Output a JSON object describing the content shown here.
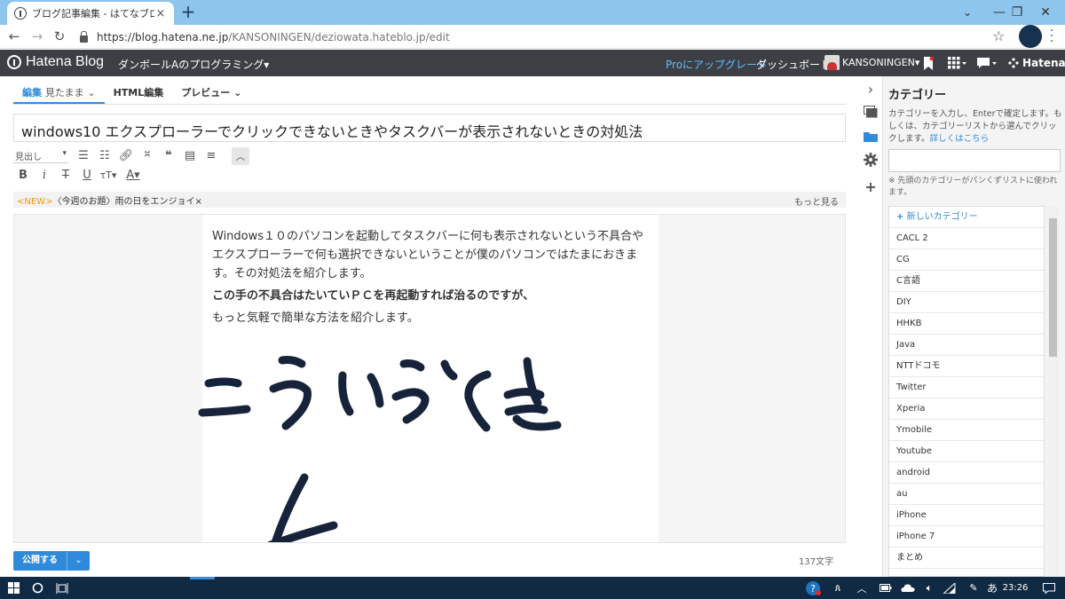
{
  "browser": {
    "tab_title": "ブログ記事編集 - はてなブログ",
    "tab_close": "×",
    "new_tab": "+",
    "url_host": "https://blog.hatena.ne.jp",
    "url_path": "/KANSONINGEN/deziowata.hateblo.jp/edit",
    "window_controls": [
      "⌄",
      "—",
      "❐",
      "✕"
    ]
  },
  "header": {
    "logo": "Hatena Blog",
    "blog_name": "ダンボールAのプログラミング▾",
    "pro_link": "Proにアップグレード",
    "dashboard": "ダッシュボード",
    "username": "KANSONINGEN▾",
    "hatena_link": "Hatena"
  },
  "editor": {
    "tabs": [
      {
        "label": "編集",
        "sub": "見たまま"
      },
      {
        "label": "HTML編集"
      },
      {
        "label": "プレビュー"
      }
    ],
    "title": "windows10 エクスプローラーでクリックできないときやタスクバーが表示されないときの対処法",
    "heading_select": "見出し",
    "notice_new": "<NEW>",
    "notice_text": "〈今週のお題〉雨の日をエンジョイ",
    "notice_close": "×",
    "notice_more": "もっと見る",
    "paragraph1": "Windows１０のパソコンを起動してタスクバーに何も表示されないという不具合やエクスプローラーで何も選択できないということが僕のパソコンではたまにおきます。その対処法を紹介します。",
    "paragraph2": "この手の不具合はたいていＰＣを再起動すれば治るのですが、",
    "paragraph3": "もっと気軽で簡単な方法を紹介します。",
    "publish_label": "公開する",
    "char_count": "137文字"
  },
  "category_panel": {
    "title": "カテゴリー",
    "description": "カテゴリーを入力し、Enterで確定します。もしくは、カテゴリーリストから選んでクリックします。",
    "more_link": "詳しくはこちら",
    "note": "※ 先頭のカテゴリーがパンくずリストに使われます。",
    "new_category": "新しいカテゴリー",
    "items": [
      "CACL 2",
      "CG",
      "C言語",
      "DIY",
      "HHKB",
      "Java",
      "NTTドコモ",
      "Twitter",
      "Xperia",
      "Ymobile",
      "Youtube",
      "android",
      "au",
      "iPhone",
      "iPhone 7",
      "まとめ"
    ]
  },
  "taskbar": {
    "ime": "あ",
    "time": "23:26"
  },
  "colors": {
    "accent": "#2f8bd9",
    "header_bg": "#3d3f44",
    "taskbar_bg": "#102a44",
    "tabstrip_bg": "#8ec5ec",
    "notice_new": "#f39800",
    "ink": "#17233a"
  }
}
